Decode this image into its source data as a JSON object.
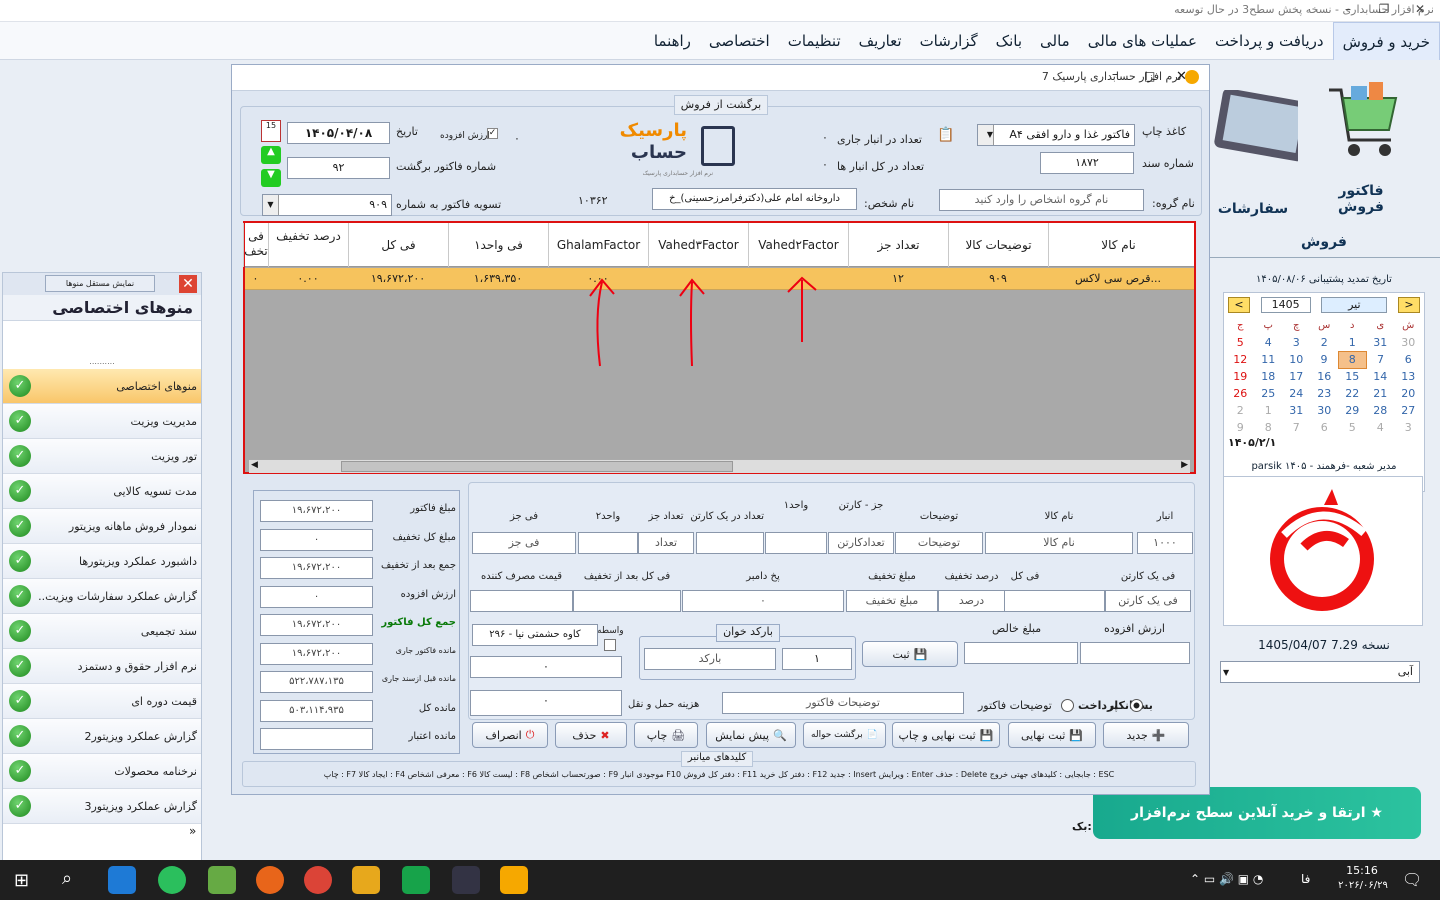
{
  "app": {
    "title": "نرم افزار حسابداری - نسخه پخش سطح3 در حال توسعه",
    "window_title": "نرم افزار حسابداری پارسیک 7"
  },
  "menu": [
    "خرید و فروش",
    "دریافت و پرداخت",
    "عملیات های مالی",
    "مالی",
    "بانک",
    "گزارشات",
    "تعاریف",
    "تنظیمات",
    "اختصاصی",
    "راهنما"
  ],
  "sidebar": {
    "show_button": "نمایش مستقل منوها",
    "title": "منوهای اختصاصی",
    "dots": "..........",
    "items": [
      "منوهای اختصاصی",
      "مدیریت ویزیت",
      "تور ویزیت",
      "مدت تسویه کالایی",
      "نمودار فروش ماهانه ویزیتور",
      "داشبورد عملکرد ویزیتورها",
      "گزارش عملکرد سفارشات ویزیت...",
      "سند تجمیعی",
      "نرم افزار حقوق و دستمزد",
      "قیمت دوره ای",
      "گزارش عملکرد ویزیتور2",
      "نرخنامه محصولات",
      "گزارش عملکرد ویزیتور3"
    ],
    "more": "»"
  },
  "right_panel": {
    "tiles": [
      "فاکتور فروش",
      "سفارشات ویز"
    ],
    "section": "فروش",
    "backup_text": "تاریخ تمدید پشتیبانی ۱۴۰۵/۰۸/۰۶",
    "cal_year": "1405",
    "cal_month": "تیر",
    "weekdays": [
      "ش",
      "ی",
      "د",
      "س",
      "چ",
      "پ",
      "ج"
    ],
    "weeks": [
      [
        "30",
        "31",
        "1",
        "2",
        "3",
        "4",
        "5"
      ],
      [
        "6",
        "7",
        "8",
        "9",
        "10",
        "11",
        "12"
      ],
      [
        "13",
        "14",
        "15",
        "16",
        "17",
        "18",
        "19"
      ],
      [
        "20",
        "21",
        "22",
        "23",
        "24",
        "25",
        "26"
      ],
      [
        "27",
        "28",
        "29",
        "30",
        "31",
        "1",
        "2"
      ],
      [
        "3",
        "4",
        "5",
        "6",
        "7",
        "8",
        "9"
      ]
    ],
    "cal_footer": "۱۴۰۵/۲/۱",
    "company": "parsik ۱۴۰۵ - مدیر شعبه -فرهمند",
    "version": "نسخه 7.29 1405/04/07",
    "theme": "آبی",
    "upgrade": "ارتقا و خرید آنلاین سطح نرم‌افزار",
    "bottom_text": "بک:"
  },
  "form": {
    "group_title": "برگشت از فروش",
    "labels": {
      "paper": "کاغذ چاپ",
      "doc_no": "شماره سند",
      "group_name": "نام گروه:",
      "stock_current": "تعداد در انبار جاری",
      "stock_all": "تعداد در کل انبار ها",
      "person": "نام شخص:",
      "date": "تاریخ",
      "vat": "ارزش افزوده",
      "return_no": "شماره فاکتور برگشت",
      "settle": "تسویه فاکتور به شماره"
    },
    "paper": "A۴ فاکتور غذا و دارو افقی",
    "doc_no": "۱۸۷۲",
    "group_ph": "نام گروه اشخاص را وارد کنید",
    "person": "داروخانه امام علی(دکترفرامرزحسینی)_خ",
    "person_code": "۱۰۳۶۲",
    "date": "۱۴۰۵/۰۴/۰۸",
    "return_no": "۹۲",
    "settle_no": "۹۰۹",
    "zero": "۰",
    "logo": "پارسیک",
    "logo2": "حساب",
    "logo_sub": "نرم افزار حسابداری پارسیک"
  },
  "grid": {
    "headers": [
      "نام کالا",
      "توضیحات کالا",
      "تعداد جز",
      "Vahed۲Factor",
      "Vahed۳Factor",
      "GhalamFactor",
      "فی واحد۱",
      "فی کل",
      "درصد تخفیف",
      "فی تخف"
    ],
    "row": [
      "قرص سی لاکس...",
      "۹۰۹",
      "۱۲",
      "",
      "",
      "۰.۰۰",
      "۱،۶۳۹،۳۵۰",
      "۱۹،۶۷۲،۲۰۰",
      "۰.۰۰",
      "۰"
    ]
  },
  "entry": {
    "labels": [
      "انبار",
      "نام کالا",
      "توضیحات",
      "جز - کارتن",
      "واحد۱",
      "تعداد در یک کارتن",
      "تعداد جز",
      "واحد۲",
      "فی جز"
    ],
    "values": [
      "۱۰۰۰",
      "نام کالا",
      "توضیحات",
      "تعدادکارتن",
      "",
      "",
      "تعداد",
      "",
      "فی جز"
    ],
    "labels2": [
      "فی یک کارتن",
      "فی کل",
      "درصد تخفیف",
      "مبلغ تخفیف",
      "پخ دامبر",
      "فی کل بعد از تخفیف",
      "قیمت مصرف کننده"
    ],
    "values2": [
      "فی یک کارتن",
      "",
      "درصد",
      "مبلغ تخفیف",
      "۰",
      "",
      ""
    ],
    "vat": "ارزش افزوده",
    "net": "مبلغ خالص",
    "save": "ثبت",
    "barcode_title": "بارکد خوان",
    "barcode": "بارکد",
    "qty": "۱",
    "broker": "واسطه",
    "broker_value": "کاوه حشمتی نیا - ۲۹۶",
    "zero": "۰",
    "ship": "هزینه حمل و نقل",
    "ship_value": "۰",
    "desc_label": "توضیحات فاکتور",
    "desc": "توضیحات فاکتور",
    "creditor": "بستانکار",
    "payment": "پرداخت"
  },
  "totals": {
    "labels": [
      "مبلغ فاکتور",
      "مبلغ کل تخفیف",
      "جمع بعد از تخفیف",
      "ارزش افزوده",
      "جمع کل فاکتور",
      "مانده فاکتور جاری",
      "مانده قبل ازسند جاری",
      "مانده کل",
      "مانده اعتبار"
    ],
    "values": [
      "۱۹،۶۷۲،۲۰۰",
      "۰",
      "۱۹،۶۷۲،۲۰۰",
      "۰",
      "۱۹،۶۷۲،۲۰۰",
      "۱۹،۶۷۲،۲۰۰",
      "۵۲۲،۷۸۷،۱۳۵",
      "۵۰۳،۱۱۴،۹۳۵",
      ""
    ]
  },
  "buttons": [
    "جدید",
    "ثبت نهایی",
    "ثبت نهایی و چاپ",
    "برگشت حواله",
    "پیش نمایش",
    "چاپ",
    "حذف",
    "انصراف"
  ],
  "shortcuts_title": "کلیدهای میانبر",
  "shortcuts": "چاپ : F7  ایجاد کالا : F4  معرفی اشخاص : F6  لیست کالا : F8  صورتحساب اشخاص : F9  موجودی انبار F10  دفتر کل فروش : F11  دفتر کل خرید : F12  جدید : Insert  ویرایش : Enter  حذف : Delete  جابجایی : کلیدهای جهتی  خروج : ESC",
  "tray": {
    "lang": "فا",
    "time": "15:16",
    "date": "۲۰۲۶/۰۶/۲۹"
  }
}
